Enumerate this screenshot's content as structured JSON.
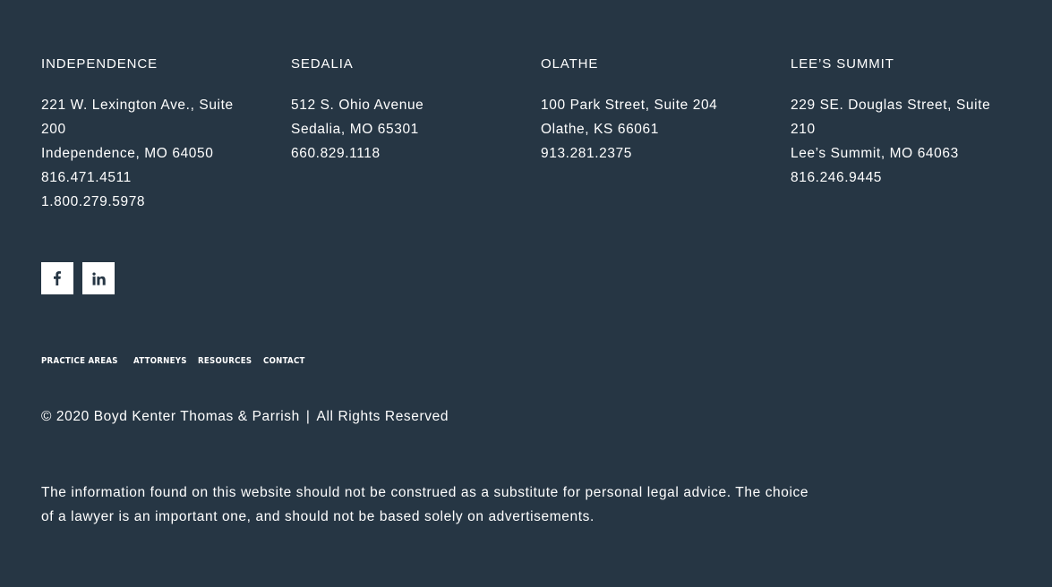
{
  "locations": [
    {
      "name": "INDEPENDENCE",
      "lines": [
        "221 W. Lexington Ave., Suite 200",
        "Independence, MO 64050",
        "816.471.4511",
        "1.800.279.5978"
      ]
    },
    {
      "name": "SEDALIA",
      "lines": [
        "512 S. Ohio Avenue",
        "Sedalia, MO 65301",
        "660.829.1118"
      ]
    },
    {
      "name": "OLATHE",
      "lines": [
        "100 Park Street, Suite 204",
        "Olathe, KS 66061",
        "913.281.2375"
      ]
    },
    {
      "name": "LEE’S SUMMIT",
      "lines": [
        "229 SE. Douglas Street, Suite 210",
        "Lee’s Summit, MO 64063",
        "816.246.9445"
      ]
    }
  ],
  "social": {
    "facebook_icon": "facebook-icon",
    "linkedin_icon": "linkedin-icon"
  },
  "nav": [
    "PRACTICE AREAS",
    "ATTORNEYS",
    "RESOURCES",
    "CONTACT"
  ],
  "copyright": {
    "text": "© 2020 Boyd Kenter Thomas & Parrish",
    "separator": "|",
    "rights": "All Rights Reserved"
  },
  "disclaimer": "The information found on this website should not be construed as a substitute for personal legal advice. The choice of a lawyer is an important one, and should not be based solely on advertisements.",
  "colors": {
    "background": "#263644",
    "text": "#ffffff",
    "icon": "#263644"
  }
}
